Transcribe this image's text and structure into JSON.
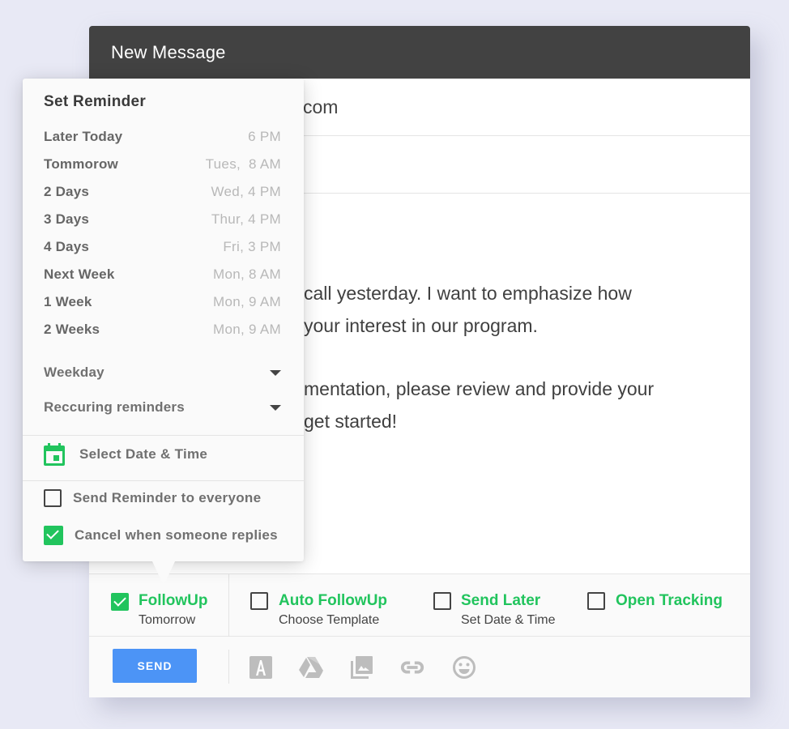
{
  "compose": {
    "title": "New Message",
    "to_value": "com",
    "subject_value": "",
    "body_lines": [
      "call yesterday. I want to emphasize how",
      "your interest in our program.",
      "mentation, please review and provide your",
      "get started!"
    ]
  },
  "reminder_popup": {
    "title": "Set Reminder",
    "options": [
      {
        "label": "Later Today",
        "time": "6 PM"
      },
      {
        "label": "Tommorow",
        "time": "Tues,  8 AM"
      },
      {
        "label": "2 Days",
        "time": "Wed, 4 PM"
      },
      {
        "label": "3 Days",
        "time": "Thur, 4 PM"
      },
      {
        "label": "4 Days",
        "time": "Fri, 3 PM"
      },
      {
        "label": "Next Week",
        "time": "Mon, 8 AM"
      },
      {
        "label": "1 Week",
        "time": "Mon, 9 AM"
      },
      {
        "label": "2 Weeks",
        "time": "Mon, 9 AM"
      }
    ],
    "dropdowns": [
      {
        "label": "Weekday"
      },
      {
        "label": "Reccuring reminders"
      }
    ],
    "select_date_time": "Select Date & Time",
    "checkboxes": [
      {
        "label": "Send Reminder to everyone",
        "checked": false
      },
      {
        "label": "Cancel when someone replies",
        "checked": true
      }
    ]
  },
  "options_bar": {
    "items": [
      {
        "title": "FollowUp",
        "subtitle": "Tomorrow",
        "checked": true
      },
      {
        "title": "Auto FollowUp",
        "subtitle": "Choose Template",
        "checked": false
      },
      {
        "title": "Send Later",
        "subtitle": "Set Date & Time",
        "checked": false
      },
      {
        "title": "Open Tracking",
        "subtitle": "",
        "checked": false
      }
    ]
  },
  "footer": {
    "send_label": "SEND",
    "icons": [
      "format-text-icon",
      "google-drive-icon",
      "insert-photo-icon",
      "insert-link-icon",
      "emoji-icon"
    ]
  },
  "colors": {
    "accent_green": "#21c45d",
    "send_blue": "#4c94f6",
    "titlebar": "#424242",
    "background": "#e8e9f5"
  }
}
